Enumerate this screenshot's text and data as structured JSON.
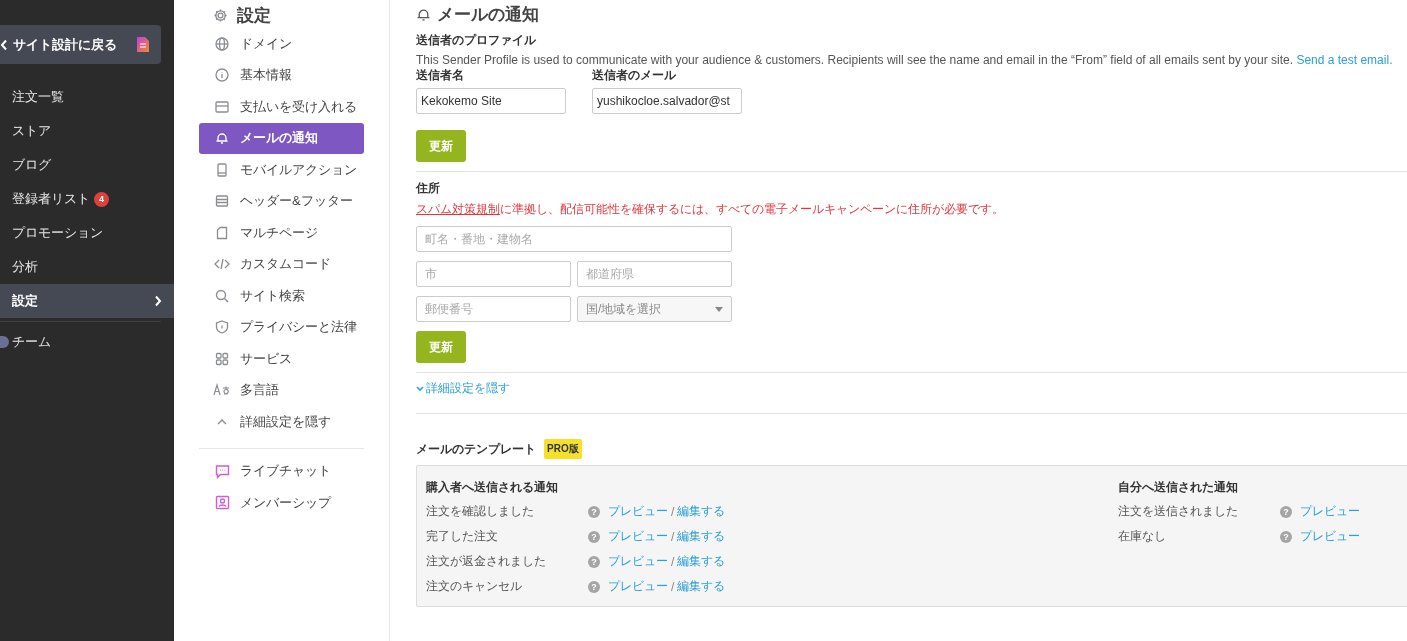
{
  "app_sidebar": {
    "back_button": "サイト設計に戻る",
    "items": [
      {
        "label": "注文一覧",
        "selected": false
      },
      {
        "label": "ストア",
        "selected": false
      },
      {
        "label": "ブログ",
        "selected": false
      },
      {
        "label": "登録者リスト",
        "selected": false,
        "badge": "4"
      },
      {
        "label": "プロモーション",
        "selected": false
      },
      {
        "label": "分析",
        "selected": false
      },
      {
        "label": "設定",
        "selected": true
      }
    ],
    "team_item": "チーム"
  },
  "settings_nav": {
    "title": "設定",
    "items": [
      {
        "label": "ドメイン",
        "selected": false
      },
      {
        "label": "基本情報",
        "selected": false
      },
      {
        "label": "支払いを受け入れる",
        "selected": false
      },
      {
        "label": "メールの通知",
        "selected": true
      },
      {
        "label": "モバイルアクション",
        "selected": false
      },
      {
        "label": "ヘッダー&フッター",
        "selected": false
      },
      {
        "label": "マルチページ",
        "selected": false
      },
      {
        "label": "カスタムコード",
        "selected": false
      },
      {
        "label": "サイト検索",
        "selected": false
      },
      {
        "label": "プライバシーと法律",
        "selected": false
      },
      {
        "label": "サービス",
        "selected": false
      },
      {
        "label": "多言語",
        "selected": false
      },
      {
        "label": "詳細設定を隠す",
        "selected": false
      }
    ],
    "extra_items": [
      "ライブチャット",
      "メンバーシップ"
    ]
  },
  "main": {
    "title": "メールの通知",
    "sender_profile": {
      "heading": "送信者のプロファイル",
      "description": "This Sender Profile is used to communicate with your audience & customers. Recipients will see the name and email in the “From” field of all emails sent by your site.",
      "link": "Send a test email.",
      "fields": [
        {
          "label": "送信者名",
          "value": "Kekokemo Site"
        },
        {
          "label": "送信者のメール",
          "value": "yushikocloe.salvador@st"
        }
      ],
      "button": "更新"
    },
    "address": {
      "heading": "住所",
      "notice_link": "スパム対策規制",
      "notice": "に準拠し、配信可能性を確保するには、すべての電子メールキャンペーンに住所が必要です。",
      "rows": [
        [
          {
            "kind": "text",
            "placeholder": "町名・番地・建物名"
          }
        ],
        [
          {
            "kind": "text",
            "placeholder": "市"
          },
          {
            "kind": "text",
            "placeholder": "都道府県"
          }
        ],
        [
          {
            "kind": "text",
            "placeholder": "郵便番号"
          },
          {
            "kind": "select",
            "placeholder": "国/地域を選択"
          }
        ]
      ],
      "button": "更新"
    },
    "advanced_toggle": "詳細設定を隠す",
    "templates": {
      "heading": "メールのテンプレート",
      "badge": "PRO版",
      "groups": [
        {
          "heading": "購入者へ送信される通知",
          "rows": [
            {
              "name": "注文を確認しました",
              "help": "?",
              "preview": "プレビュー",
              "separator": "/",
              "edit": "編集する"
            },
            {
              "name": "完了した注文",
              "help": "?",
              "preview": "プレビュー",
              "separator": "/",
              "edit": "編集する"
            },
            {
              "name": "注文が返金されました",
              "help": "?",
              "preview": "プレビュー",
              "separator": "/",
              "edit": "編集する"
            },
            {
              "name": "注文のキャンセル",
              "help": "?",
              "preview": "プレビュー",
              "separator": "/",
              "edit": "編集する"
            }
          ]
        },
        {
          "heading": "自分へ送信された通知",
          "rows": [
            {
              "name": "注文を送信されました",
              "help": "?",
              "preview": "プレビュー"
            },
            {
              "name": "在庫なし",
              "help": "?",
              "preview": "プレビュー"
            }
          ]
        }
      ]
    }
  }
}
